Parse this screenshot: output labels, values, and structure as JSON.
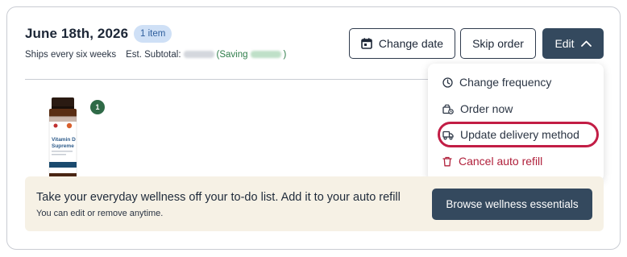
{
  "order": {
    "date": "June 18th, 2026",
    "item_count": "1 item",
    "frequency": "Ships every six weeks",
    "subtotal_label": "Est. Subtotal:",
    "saving_open": "(Saving",
    "saving_close": ")"
  },
  "actions": {
    "change_date": "Change date",
    "skip_order": "Skip order",
    "edit": "Edit"
  },
  "menu": {
    "items": [
      {
        "label": "Change frequency",
        "icon": "clock-icon"
      },
      {
        "label": "Order now",
        "icon": "box-refresh-icon"
      },
      {
        "label": "Update delivery method",
        "icon": "delivery-truck-icon"
      },
      {
        "label": "Cancel auto refill",
        "icon": "trash-icon"
      }
    ]
  },
  "product": {
    "quantity": "1",
    "brand": "Vitamin D",
    "name": "Supreme"
  },
  "banner": {
    "title": "Take your everyday wellness off your to-do list. Add it to your auto refill",
    "subtitle": "You can edit or remove anytime.",
    "button": "Browse wellness essentials"
  },
  "colors": {
    "primary": "#34495e",
    "badge_bg": "#cfe0f6",
    "danger": "#b0203b",
    "highlight_ring": "#c21d45",
    "saving": "#2e7d4a",
    "banner_bg": "#f6f1e5"
  }
}
